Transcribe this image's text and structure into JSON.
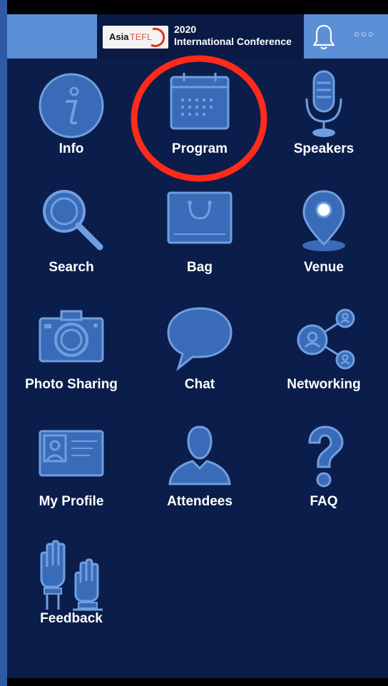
{
  "header": {
    "logo_brand": "Asia",
    "logo_brand_suffix": "TEFL",
    "conference_year": "2020",
    "conference_title": "International Conference",
    "notification_icon": "bell-icon",
    "more_icon": "more-dots-icon",
    "more_text": "○○○"
  },
  "menu": {
    "items": [
      {
        "label": "Info",
        "icon": "info-icon"
      },
      {
        "label": "Program",
        "icon": "calendar-icon"
      },
      {
        "label": "Speakers",
        "icon": "microphone-icon"
      },
      {
        "label": "Search",
        "icon": "magnifier-icon"
      },
      {
        "label": "Bag",
        "icon": "bag-icon"
      },
      {
        "label": "Venue",
        "icon": "location-pin-icon"
      },
      {
        "label": "Photo Sharing",
        "icon": "camera-icon"
      },
      {
        "label": "Chat",
        "icon": "chat-bubble-icon"
      },
      {
        "label": "Networking",
        "icon": "network-icon"
      },
      {
        "label": "My Profile",
        "icon": "id-card-icon"
      },
      {
        "label": "Attendees",
        "icon": "person-icon"
      },
      {
        "label": "FAQ",
        "icon": "question-icon"
      },
      {
        "label": "Feedback",
        "icon": "raised-hands-icon"
      }
    ]
  },
  "colors": {
    "background": "#0b1d4a",
    "header_accent": "#5b8fd6",
    "icon_fill": "#3a6bb8",
    "icon_stroke": "#6f9fe0",
    "highlight": "#ff2a1a"
  }
}
